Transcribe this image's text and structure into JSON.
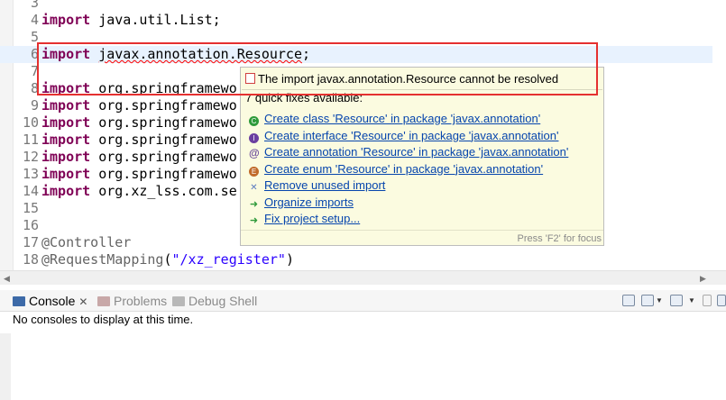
{
  "editor": {
    "lines": [
      {
        "num": "3",
        "text": ""
      },
      {
        "num": "4",
        "kw": "import",
        "rest": " java.util.List;"
      },
      {
        "num": "5",
        "text": ""
      },
      {
        "num": "6",
        "kw": "import",
        "err": "javax.annotation.Resource",
        "rest": ";"
      },
      {
        "num": "7",
        "text": ""
      },
      {
        "num": "8",
        "kw": "import",
        "rest": " org.springframewo"
      },
      {
        "num": "9",
        "kw": "import",
        "rest": " org.springframewo"
      },
      {
        "num": "10",
        "kw": "import",
        "rest": " org.springframewo"
      },
      {
        "num": "11",
        "kw": "import",
        "rest": " org.springframewo"
      },
      {
        "num": "12",
        "kw": "import",
        "rest": " org.springframewo"
      },
      {
        "num": "13",
        "kw": "import",
        "rest": " org.springframewo"
      },
      {
        "num": "14",
        "kw": "import",
        "rest": " org.xz_lss.com.se"
      },
      {
        "num": "15",
        "text": ""
      },
      {
        "num": "16",
        "text": ""
      },
      {
        "num": "17",
        "ann": "@Controller"
      },
      {
        "num": "18",
        "ann": "@RequestMapping",
        "paren": "(",
        "str": "\"/xz_register\"",
        "close": ")"
      }
    ]
  },
  "hover": {
    "problem": "The import javax.annotation.Resource cannot be resolved",
    "count": "7 quick fixes available:",
    "fixes": [
      {
        "label": "Create class 'Resource' in package 'javax.annotation'",
        "icon": "class-icon",
        "glyph": "C"
      },
      {
        "label": "Create interface 'Resource' in package 'javax.annotation'",
        "icon": "interface-icon",
        "glyph": "I"
      },
      {
        "label": "Create annotation 'Resource' in package 'javax.annotation'",
        "icon": "annotation-icon",
        "glyph": "@"
      },
      {
        "label": "Create enum 'Resource' in package 'javax.annotation'",
        "icon": "enum-icon",
        "glyph": "E"
      },
      {
        "label": "Remove unused import",
        "icon": "remove-import-icon",
        "glyph": "✕"
      },
      {
        "label": "Organize imports",
        "icon": "organize-imports-icon",
        "glyph": "➜"
      },
      {
        "label": "Fix project setup...",
        "icon": "project-setup-icon",
        "glyph": "➜"
      }
    ],
    "status": "Press 'F2' for focus"
  },
  "console": {
    "tabs": [
      {
        "label": "Console",
        "icon": "console-icon",
        "close": "✕"
      },
      {
        "label": "Problems",
        "icon": "problems-icon"
      },
      {
        "label": "Debug Shell",
        "icon": "debug-shell-icon"
      }
    ],
    "message": "No consoles to display at this time."
  },
  "colors": {
    "keyword": "#7f0055",
    "error_highlight": "#e53030",
    "hover_bg": "#fbfbe0",
    "link": "#0645ad"
  }
}
